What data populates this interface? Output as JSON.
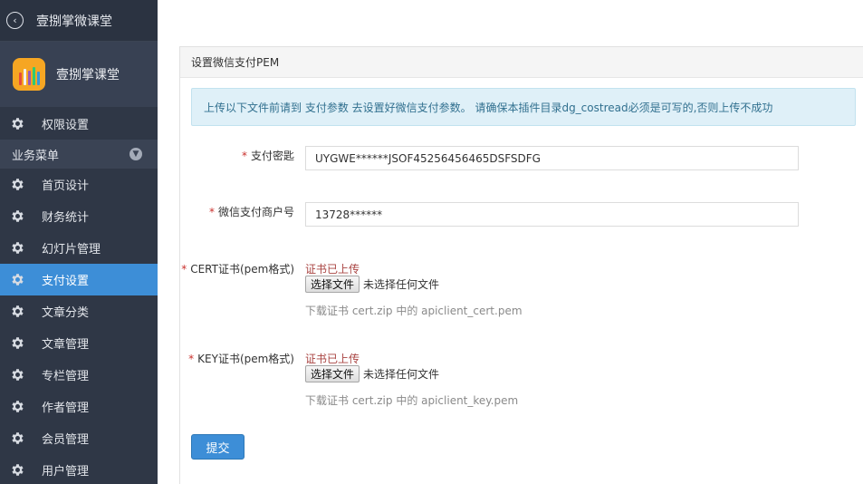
{
  "sidebar": {
    "top_title": "壹捌掌微课堂",
    "brand_title": "壹捌掌课堂",
    "top_item": {
      "label": "权限设置",
      "icon": "gear-icon"
    },
    "group_label": "业务菜单",
    "items": [
      {
        "label": "首页设计",
        "icon": "gear-icon",
        "active": false
      },
      {
        "label": "财务统计",
        "icon": "gear-icon",
        "active": false
      },
      {
        "label": "幻灯片管理",
        "icon": "gear-icon",
        "active": false
      },
      {
        "label": "支付设置",
        "icon": "gear-icon",
        "active": true
      },
      {
        "label": "文章分类",
        "icon": "gear-icon",
        "active": false
      },
      {
        "label": "文章管理",
        "icon": "gear-icon",
        "active": false
      },
      {
        "label": "专栏管理",
        "icon": "gear-icon",
        "active": false
      },
      {
        "label": "作者管理",
        "icon": "gear-icon",
        "active": false
      },
      {
        "label": "会员管理",
        "icon": "gear-icon",
        "active": false
      },
      {
        "label": "用户管理",
        "icon": "gear-icon",
        "active": false
      }
    ]
  },
  "panel": {
    "title": "设置微信支付PEM",
    "alert": "上传以下文件前请到 支付参数 去设置好微信支付参数。 请确保本插件目录dg_costread必须是可写的,否则上传不成功"
  },
  "form": {
    "required_mark": "*",
    "pay_key": {
      "label": "支付密匙",
      "value": "UYGWE******JSOF45256456465DSFSDFG"
    },
    "merchant_id": {
      "label": "微信支付商户号",
      "value": "13728******"
    },
    "cert": {
      "label": "CERT证书(pem格式)",
      "status": "证书已上传",
      "button": "选择文件",
      "no_file": "未选择任何文件",
      "help": "下载证书 cert.zip 中的 apiclient_cert.pem"
    },
    "key": {
      "label": "KEY证书(pem格式)",
      "status": "证书已上传",
      "button": "选择文件",
      "no_file": "未选择任何文件",
      "help": "下载证书 cert.zip 中的 apiclient_key.pem"
    },
    "submit_label": "提交"
  },
  "colors": {
    "sidebar_bg": "#2f3746",
    "active_bg": "#3d8ed7",
    "required": "#c9302c",
    "alert_bg": "#dff0f8"
  }
}
